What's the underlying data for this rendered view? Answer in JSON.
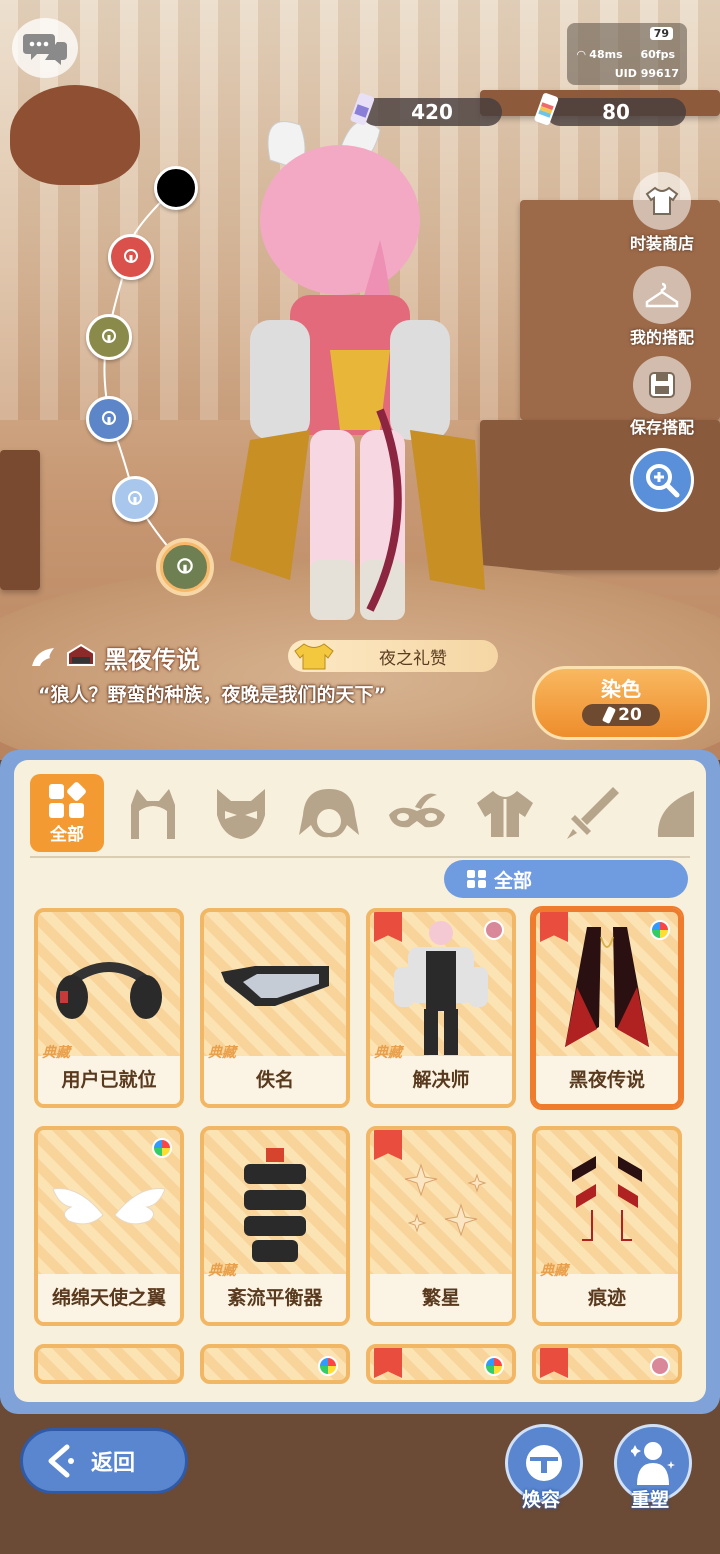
{
  "status": {
    "battery": "79",
    "ping": "48ms",
    "fps": "60fps",
    "uid": "UID 99617"
  },
  "currency": {
    "paint_a": "420",
    "paint_b": "80"
  },
  "side_menu": [
    {
      "label": "时装商店",
      "icon": "shirt-icon"
    },
    {
      "label": "我的搭配",
      "icon": "hanger-icon"
    },
    {
      "label": "保存搭配",
      "icon": "save-icon"
    }
  ],
  "outfit": {
    "name": "黑夜传说",
    "quote": "“狼人？野蛮的种族，夜晚是我们的天下”",
    "tag": "夜之礼赞"
  },
  "dye": {
    "label": "染色",
    "cost": "20"
  },
  "categories": {
    "all_label": "全部"
  },
  "subtab": {
    "label": "全部"
  },
  "items": [
    {
      "name": "用户已就位",
      "collection": "典藏",
      "selected": false
    },
    {
      "name": "佚名",
      "collection": "典藏",
      "selected": false
    },
    {
      "name": "解决师",
      "collection": "典藏",
      "selected": false
    },
    {
      "name": "黑夜传说",
      "collection": "",
      "selected": true
    },
    {
      "name": "绵绵天使之翼",
      "collection": "",
      "selected": false
    },
    {
      "name": "紊流平衡器",
      "collection": "典藏",
      "selected": false
    },
    {
      "name": "繁星",
      "collection": "",
      "selected": false
    },
    {
      "name": "痕迹",
      "collection": "典藏",
      "selected": false
    }
  ],
  "nav": {
    "back": "返回",
    "face": "焕容",
    "reshape": "重塑"
  },
  "colors": {
    "accent": "#ef7c2c",
    "panel": "#7fa3d9",
    "button": "#5a86cf"
  }
}
